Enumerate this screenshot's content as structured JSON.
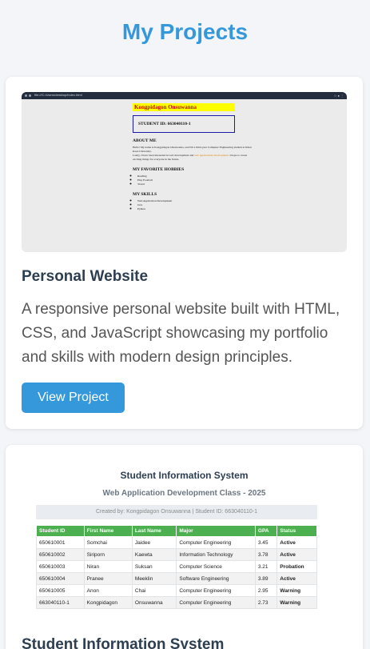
{
  "page": {
    "title": "My Projects"
  },
  "projects": [
    {
      "title": "Personal Website",
      "description": "A responsive personal website built with HTML, CSS, and JavaScript showcasing my portfolio and skills with modern design principles.",
      "button_label": "View Project",
      "thumbnail": {
        "browser_url": "file:///C:/Users/desktop/index.html",
        "name": "Kongpidagon Onsuwanna",
        "student_id": "STUDENT ID: 663040110-1",
        "about_heading": "ABOUT ME",
        "about_text_1": "Hello! My name is Kongpidagon Onsuwanna, and I'm a third-year Computer Engineering student at Khon Kaen University.",
        "about_text_2": "Lately, I have been interested in web development and",
        "about_text_orange": "web applications development.",
        "about_text_3": "I hope to create exciting things for everyone in the future.",
        "hobbies_heading": "MY FAVORITE HOBBIES",
        "hobbies": [
          "Reading",
          "Play Football",
          "Travel"
        ],
        "skills_heading": "MY SKILLS",
        "skills": [
          "Web Application Development",
          "Java",
          "Python"
        ]
      }
    },
    {
      "title": "Student Information System",
      "thumbnail": {
        "title": "Student Information System",
        "subtitle": "Web Application Development Class - 2025",
        "created_by": "Created by: Kongpidagon Onsuwanna | Student ID: 663040110-1",
        "columns": [
          "Student ID",
          "First Name",
          "Last Name",
          "Major",
          "GPA",
          "Status"
        ],
        "rows": [
          [
            "650610001",
            "Somchai",
            "Jaidee",
            "Computer Engineering",
            "3.45",
            "Active"
          ],
          [
            "650610002",
            "Siriporn",
            "Kaewta",
            "Information Technology",
            "3.78",
            "Active"
          ],
          [
            "650610003",
            "Niran",
            "Suksan",
            "Computer Science",
            "3.21",
            "Probation"
          ],
          [
            "650610004",
            "Pranee",
            "Meeklin",
            "Software Engineering",
            "3.89",
            "Active"
          ],
          [
            "650610005",
            "Anon",
            "Chai",
            "Computer Engineering",
            "2.95",
            "Warning"
          ],
          [
            "663040110-1",
            "Kongpidagon",
            "Onsuwanna",
            "Computer Engineering",
            "2.73",
            "Warning"
          ]
        ]
      }
    }
  ],
  "colors": {
    "accent": "#3498db",
    "title_text": "#2c3e50",
    "table_header": "#4caf50",
    "status_active": "#2e8b2e",
    "status_probation": "#e00000",
    "status_warning": "#ff9f00"
  }
}
